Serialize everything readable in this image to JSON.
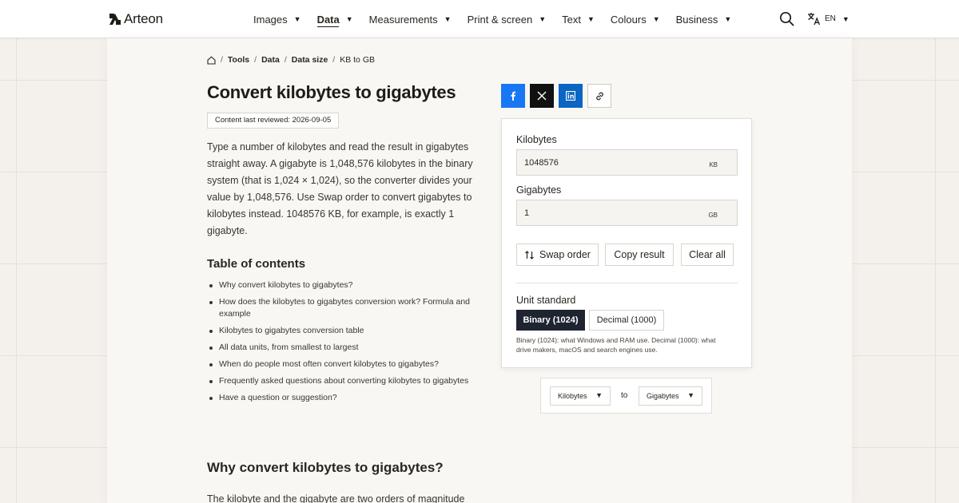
{
  "header": {
    "brand": "Arteon",
    "nav": [
      {
        "label": "Images",
        "active": false
      },
      {
        "label": "Data",
        "active": true
      },
      {
        "label": "Measurements",
        "active": false
      },
      {
        "label": "Print & screen",
        "active": false
      },
      {
        "label": "Text",
        "active": false
      },
      {
        "label": "Colours",
        "active": false
      },
      {
        "label": "Business",
        "active": false
      }
    ],
    "search_icon": "search-icon",
    "language": "EN",
    "caret": "▼"
  },
  "breadcrumb": {
    "home_icon": "home-icon",
    "items": [
      "Tools",
      "Data",
      "Data size"
    ],
    "current": "KB to GB"
  },
  "page": {
    "title": "Convert kilobytes to gigabytes",
    "reviewed": "Content last reviewed: 2026-09-05",
    "intro": "Type a number of kilobytes and read the result in gigabytes straight away. A gigabyte is 1,048,576 kilobytes in the binary system (that is 1,024 × 1,024), so the converter divides your value by 1,048,576. Use Swap order to convert gigabytes to kilobytes instead. 1048576 KB, for example, is exactly 1 gigabyte.",
    "toc_title": "Table of contents",
    "toc": [
      "Why convert kilobytes to gigabytes?",
      "How does the kilobytes to gigabytes conversion work? Formula and example",
      "Kilobytes to gigabytes conversion table",
      "All data units, from smallest to largest",
      "When do people most often convert kilobytes to gigabytes?",
      "Frequently asked questions about converting kilobytes to gigabytes",
      "Have a question or suggestion?"
    ],
    "section_heading": "Why convert kilobytes to gigabytes?",
    "section_text": "The kilobyte and the gigabyte are two orders of magnitude"
  },
  "share": {
    "icons": [
      "facebook-icon",
      "x-icon",
      "linkedin-icon",
      "link-icon"
    ],
    "colors": {
      "facebook": "#1877f2",
      "x": "#111111",
      "linkedin": "#0a66c2"
    }
  },
  "converter": {
    "from_label": "Kilobytes",
    "from_value": "1048576",
    "from_unit": "KB",
    "to_label": "Gigabytes",
    "to_value": "1",
    "to_unit": "GB",
    "swap_label": "Swap order",
    "copy_label": "Copy result",
    "clear_label": "Clear all",
    "standard_label": "Unit standard",
    "standard_binary": "Binary (1024)",
    "standard_decimal": "Decimal (1000)",
    "standard_selected": "Binary (1024)",
    "standard_note": "Binary (1024): what Windows and RAM use. Decimal (1000): what drive makers, macOS and search engines use."
  },
  "unit_selector": {
    "from": "Kilobytes",
    "connector": "to",
    "to": "Gigabytes"
  }
}
